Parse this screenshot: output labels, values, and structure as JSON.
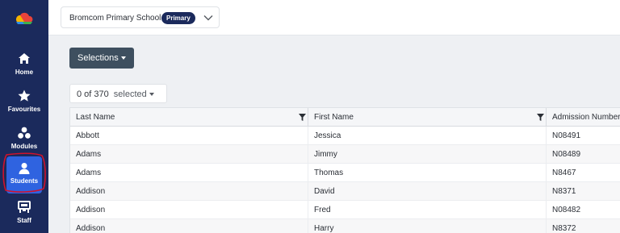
{
  "sidebar": {
    "items": [
      {
        "label": "Home",
        "icon": "home-icon"
      },
      {
        "label": "Favourites",
        "icon": "star-icon"
      },
      {
        "label": "Modules",
        "icon": "modules-icon"
      },
      {
        "label": "Students",
        "icon": "student-icon",
        "active": true
      },
      {
        "label": "Staff",
        "icon": "staff-icon"
      }
    ],
    "background": "#1b2a5c",
    "active_color": "#2f63e0",
    "annotation_color": "#d0122c"
  },
  "header": {
    "school_name": "Bromcom Primary School",
    "school_badge": "Primary"
  },
  "toolbar": {
    "selections_label": "Selections"
  },
  "selection": {
    "count_text": "0 of 370",
    "selected_label": "selected"
  },
  "table": {
    "columns": [
      "Last Name",
      "First Name",
      "Admission Number"
    ],
    "rows": [
      [
        "Abbott",
        "Jessica",
        "N08491"
      ],
      [
        "Adams",
        "Jimmy",
        "N08489"
      ],
      [
        "Adams",
        "Thomas",
        "N8467"
      ],
      [
        "Addison",
        "David",
        "N8371"
      ],
      [
        "Addison",
        "Fred",
        "N08482"
      ],
      [
        "Addison",
        "Harry",
        "N8372"
      ]
    ]
  }
}
